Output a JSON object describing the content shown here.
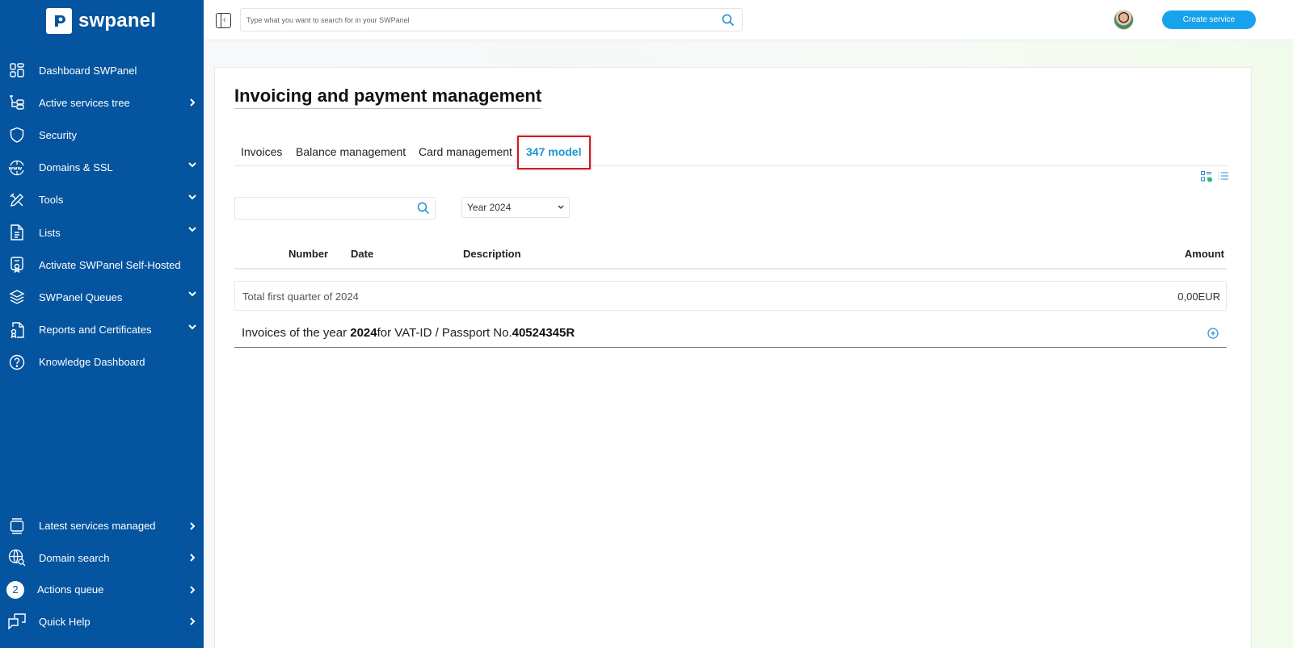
{
  "brand": {
    "name": "swpanel",
    "sidebar_color": "#04549f",
    "accent": "#17a2ee",
    "highlight_color": "#d6191b"
  },
  "sidebar": {
    "items": [
      {
        "label": "Dashboard SWPanel",
        "icon": "dashboard-icon",
        "chevron": "none"
      },
      {
        "label": "Active services tree",
        "icon": "tree-icon",
        "chevron": "right"
      },
      {
        "label": "Security",
        "icon": "shield-icon",
        "chevron": "none"
      },
      {
        "label": "Domains & SSL",
        "icon": "www-globe-icon",
        "chevron": "down"
      },
      {
        "label": "Tools",
        "icon": "tools-icon",
        "chevron": "down"
      },
      {
        "label": "Lists",
        "icon": "document-icon",
        "chevron": "down"
      },
      {
        "label": "Activate SWPanel Self-Hosted",
        "icon": "certificate-badge-icon",
        "chevron": "none"
      },
      {
        "label": "SWPanel Queues",
        "icon": "layers-icon",
        "chevron": "down"
      },
      {
        "label": "Reports and Certificates",
        "icon": "report-certificate-icon",
        "chevron": "down"
      },
      {
        "label": "Knowledge Dashboard",
        "icon": "help-circle-icon",
        "chevron": "none"
      }
    ],
    "bottom_items": [
      {
        "label": "Latest services managed",
        "icon": "monitor-icon",
        "chevron": "right"
      },
      {
        "label": "Domain search",
        "icon": "globe-search-icon",
        "chevron": "right"
      },
      {
        "label": "Actions queue",
        "badge": "2",
        "chevron": "right"
      },
      {
        "label": "Quick Help",
        "icon": "chat-bubbles-icon",
        "chevron": "right"
      }
    ]
  },
  "topbar": {
    "search_placeholder": "Type what you want to search for in your SWPanel",
    "create_button": "Create service"
  },
  "page": {
    "title": "Invoicing and payment management",
    "tabs": [
      {
        "label": "Invoices",
        "active": false
      },
      {
        "label": "Balance management",
        "active": false
      },
      {
        "label": "Card management",
        "active": false
      },
      {
        "label": "347 model",
        "active": true,
        "highlighted": true
      }
    ],
    "filter": {
      "search_value": "",
      "search_placeholder": "",
      "year_selected": "Year 2024"
    },
    "table": {
      "columns": [
        "Number",
        "Date",
        "Description",
        "Amount"
      ],
      "total_row": {
        "label": "Total first quarter of 2024",
        "amount": "0,00EUR"
      },
      "year_section": {
        "prefix": "Invoices of the year ",
        "year": "2024",
        "middle": "for VAT-ID / Passport No.",
        "id_number": "40524345R"
      }
    }
  }
}
